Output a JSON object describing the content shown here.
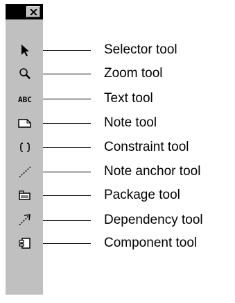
{
  "palette": {
    "close_icon": "close-x-icon",
    "tools": [
      {
        "id": "selector",
        "label": "Selector tool",
        "icon": "arrow-pointer-icon"
      },
      {
        "id": "zoom",
        "label": "Zoom tool",
        "icon": "magnifier-icon"
      },
      {
        "id": "text",
        "label": "Text tool",
        "icon": "abc-text-icon",
        "icon_text": "ABC"
      },
      {
        "id": "note",
        "label": "Note tool",
        "icon": "folded-note-icon"
      },
      {
        "id": "constraint",
        "label": "Constraint tool",
        "icon": "braces-icon"
      },
      {
        "id": "note-anchor",
        "label": "Note anchor tool",
        "icon": "dashed-line-icon"
      },
      {
        "id": "package",
        "label": "Package tool",
        "icon": "package-folder-icon"
      },
      {
        "id": "dependency",
        "label": "Dependency tool",
        "icon": "dashed-arrow-icon"
      },
      {
        "id": "component",
        "label": "Component tool",
        "icon": "component-icon"
      }
    ]
  },
  "colors": {
    "palette_bg": "#c0c0c0",
    "titlebar": "#000000",
    "page_bg": "#ffffff"
  }
}
